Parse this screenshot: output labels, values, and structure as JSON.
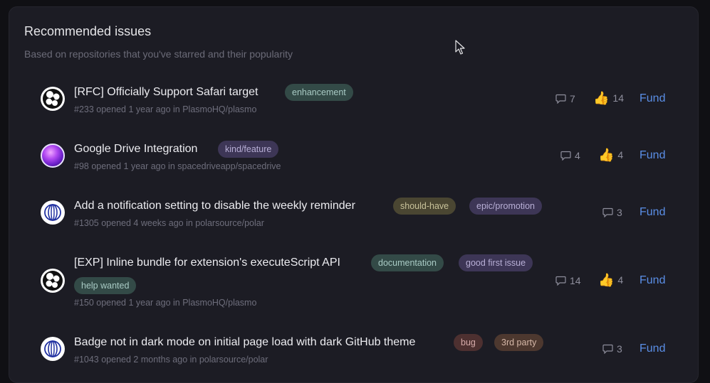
{
  "header": {
    "title": "Recommended issues",
    "subtitle": "Based on repositories that you've starred and their popularity"
  },
  "issues": [
    {
      "title": "[RFC] Officially Support Safari target",
      "meta": "#233 opened 1 year ago in PlasmoHQ/plasmo",
      "labels": [
        "enhancement"
      ],
      "comments": "7",
      "reactions": "14",
      "fund": "Fund",
      "avatar": "plasmo-logo"
    },
    {
      "title": "Google Drive Integration",
      "meta": "#98 opened 1 year ago in spacedriveapp/spacedrive",
      "labels": [
        "kind/feature"
      ],
      "comments": "4",
      "reactions": "4",
      "fund": "Fund",
      "avatar": "spacedrive-logo"
    },
    {
      "title": "Add a notification setting to disable the weekly reminder",
      "meta": "#1305 opened 4 weeks ago in polarsource/polar",
      "labels": [
        "should-have",
        "epic/promotion"
      ],
      "comments": "3",
      "fund": "Fund",
      "avatar": "polar-logo"
    },
    {
      "title": "[EXP] Inline bundle for extension's executeScript API",
      "meta": "#150 opened 1 year ago in PlasmoHQ/plasmo",
      "labels": [
        "documentation",
        "good first issue",
        "help wanted"
      ],
      "comments": "14",
      "reactions": "4",
      "fund": "Fund",
      "avatar": "plasmo-logo"
    },
    {
      "title": "Badge not in dark mode on initial page load with dark GitHub theme",
      "meta": "#1043 opened 2 months ago in polarsource/polar",
      "labels": [
        "bug",
        "3rd party"
      ],
      "comments": "3",
      "fund": "Fund",
      "avatar": "polar-logo"
    }
  ],
  "icons": {
    "comment": "comment-icon",
    "reaction": "thumbs-up-icon"
  },
  "colors": {
    "accent": "#5a8ee6",
    "card_bg": "#1c1c24",
    "page_bg": "#101014"
  }
}
